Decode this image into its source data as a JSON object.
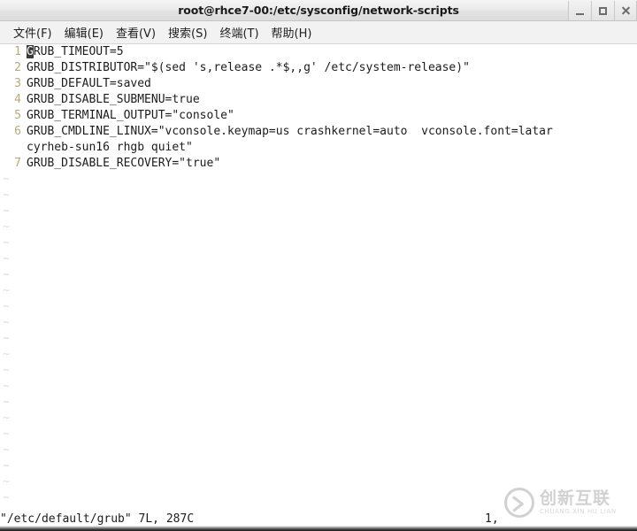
{
  "window": {
    "title": "root@rhce7-00:/etc/sysconfig/network-scripts",
    "controls": [
      {
        "name": "minimize",
        "label": "–"
      },
      {
        "name": "maximize",
        "label": "□"
      },
      {
        "name": "close",
        "label": "×"
      }
    ]
  },
  "menubar": {
    "items": [
      {
        "label": "文件(F)"
      },
      {
        "label": "编辑(E)"
      },
      {
        "label": "查看(V)"
      },
      {
        "label": "搜索(S)"
      },
      {
        "label": "终端(T)"
      },
      {
        "label": "帮助(H)"
      }
    ]
  },
  "editor": {
    "cursor_char": "G",
    "lines": [
      {
        "number": "1",
        "text": "RUB_TIMEOUT=5",
        "has_cursor": true
      },
      {
        "number": "2",
        "text": "GRUB_DISTRIBUTOR=\"$(sed 's,release .*$,,g' /etc/system-release)\"",
        "has_cursor": false
      },
      {
        "number": "3",
        "text": "GRUB_DEFAULT=saved",
        "has_cursor": false
      },
      {
        "number": "4",
        "text": "GRUB_DISABLE_SUBMENU=true",
        "has_cursor": false
      },
      {
        "number": "5",
        "text": "GRUB_TERMINAL_OUTPUT=\"console\"",
        "has_cursor": false
      },
      {
        "number": "6",
        "text": "GRUB_CMDLINE_LINUX=\"vconsole.keymap=us crashkernel=auto  vconsole.font=latar",
        "has_cursor": false
      },
      {
        "number": "",
        "text": "cyrheb-sun16 rhgb quiet\"",
        "has_cursor": false
      },
      {
        "number": "7",
        "text": "GRUB_DISABLE_RECOVERY=\"true\"",
        "has_cursor": false
      }
    ],
    "empty_marker": "~",
    "empty_line_count": 21
  },
  "statusline": {
    "file_info": "\"/etc/default/grub\" 7L, 287C",
    "cursor_position": "1,"
  },
  "watermark": {
    "chinese": "创新互联",
    "pinyin": "CHUANG XIN HU LIAN"
  },
  "colors": {
    "background": "#ffffff",
    "text": "#1c1c1c",
    "line_number": "#b8a978",
    "tilde": "#cfe2e0",
    "cursor_block": "#3a3a3a",
    "titlebar": "#ececec"
  }
}
